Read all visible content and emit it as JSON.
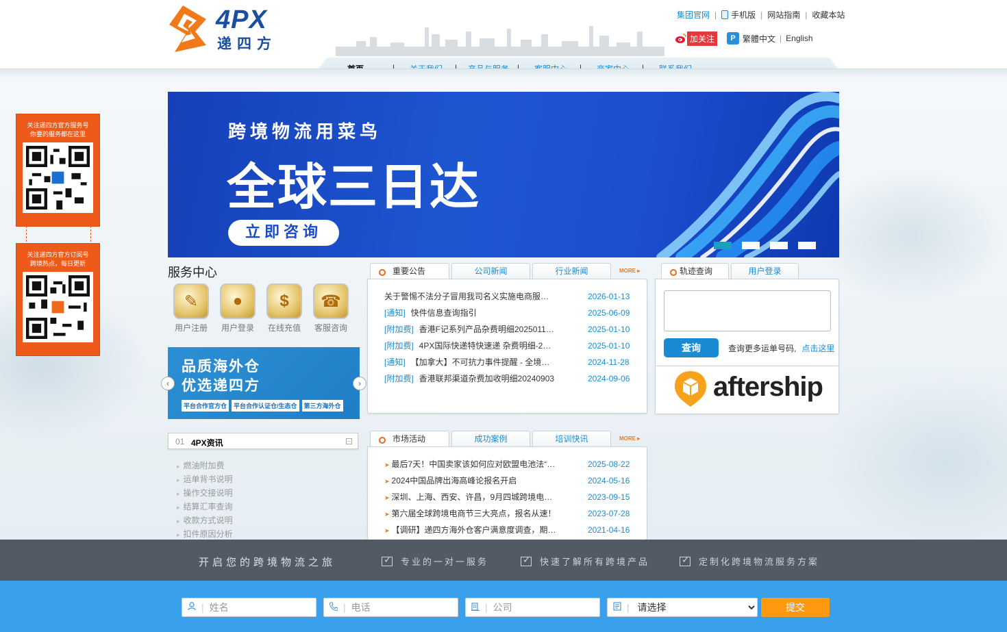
{
  "header": {
    "logo_text": "4PX",
    "logo_cn": "递四方",
    "toplinks": [
      "集团官网",
      "手机版",
      "网站指南",
      "收藏本站"
    ],
    "weibo_follow": "加关注",
    "lang_trad": "繁體中文",
    "lang_en": "English"
  },
  "nav": {
    "items": [
      "首页",
      "关于我们",
      "产品与服务",
      "客服中心",
      "商家中心",
      "联系我们"
    ],
    "separator": "|"
  },
  "side_qr": [
    {
      "text1": "关注递四方官方服务号",
      "text2": "你要的服务都在这里"
    },
    {
      "text1": "关注递四方官方订阅号",
      "text2": "跨境热点，每日更新"
    }
  ],
  "banner": {
    "line1": "跨境物流用菜鸟",
    "line2": "全球三日达",
    "button": "立即咨询"
  },
  "service_center": {
    "title": "服务中心",
    "items": [
      {
        "label": "用户注册",
        "icon": "register-icon"
      },
      {
        "label": "用户登录",
        "icon": "login-icon"
      },
      {
        "label": "在线充值",
        "icon": "dollar-icon"
      },
      {
        "label": "客服咨询",
        "icon": "phone-icon"
      }
    ]
  },
  "promo": {
    "line1": "品质海外仓",
    "line2": "优选递四方",
    "tags": [
      "平台合作官方仓",
      "平台合作认证仓/生态仓",
      "第三方海外仓"
    ]
  },
  "info": {
    "num": "01",
    "title": "4PX资讯",
    "links": [
      "燃油附加费",
      "运单背书说明",
      "操作交接说明",
      "结算汇率查询",
      "收款方式说明",
      "扣件原因分析"
    ]
  },
  "news": {
    "tabs": [
      "重要公告",
      "公司新闻",
      "行业新闻"
    ],
    "more": "MORE",
    "rows": [
      {
        "cat": "",
        "title": "关于警惕不法分子冒用我司名义实施电商服…",
        "date": "2026-01-13"
      },
      {
        "cat": "[通知]",
        "title": "快件信息查询指引",
        "date": "2025-06-09"
      },
      {
        "cat": "[附加费]",
        "title": "香港F记系列产品杂费明细2025011…",
        "date": "2025-01-10"
      },
      {
        "cat": "[附加费]",
        "title": "4PX国际快递特快速递 杂费明细-2…",
        "date": "2025-01-10"
      },
      {
        "cat": "[通知]",
        "title": "【加拿大】不可抗力事件提醒 - 全境…",
        "date": "2024-11-28"
      },
      {
        "cat": "[附加费]",
        "title": "香港联邦渠道杂费加收明细20240903",
        "date": "2024-09-06"
      }
    ]
  },
  "activities": {
    "tabs": [
      "市场活动",
      "成功案例",
      "培训快讯"
    ],
    "more": "MORE",
    "rows": [
      {
        "title": "最后7天！中国卖家该如何应对欧盟电池法“…",
        "date": "2025-08-22"
      },
      {
        "title": "2024中国品牌出海高峰论报名开启",
        "date": "2024-05-16"
      },
      {
        "title": "深圳、上海、西安、许昌，9月四城跨境电…",
        "date": "2023-09-15"
      },
      {
        "title": "第六届全球跨境电商节三大亮点，报名从速！",
        "date": "2023-07-28"
      },
      {
        "title": "【调研】递四方海外仓客户满意度调查，期…",
        "date": "2021-04-16"
      }
    ]
  },
  "tracking": {
    "tabs": [
      "轨迹查询",
      "用户登录"
    ],
    "button": "查询",
    "hint": "查询更多运单号码,",
    "hint_link": "点击这里",
    "partner": "aftership"
  },
  "footer": {
    "slogan": "开启您的跨境物流之旅",
    "features": [
      "专业的一对一服务",
      "快速了解所有跨境产品",
      "定制化跨境物流服务方案"
    ],
    "form": {
      "name_placeholder": "姓名",
      "phone_placeholder": "电话",
      "company_placeholder": "公司",
      "select_value": "请选择",
      "submit": "提交"
    }
  }
}
